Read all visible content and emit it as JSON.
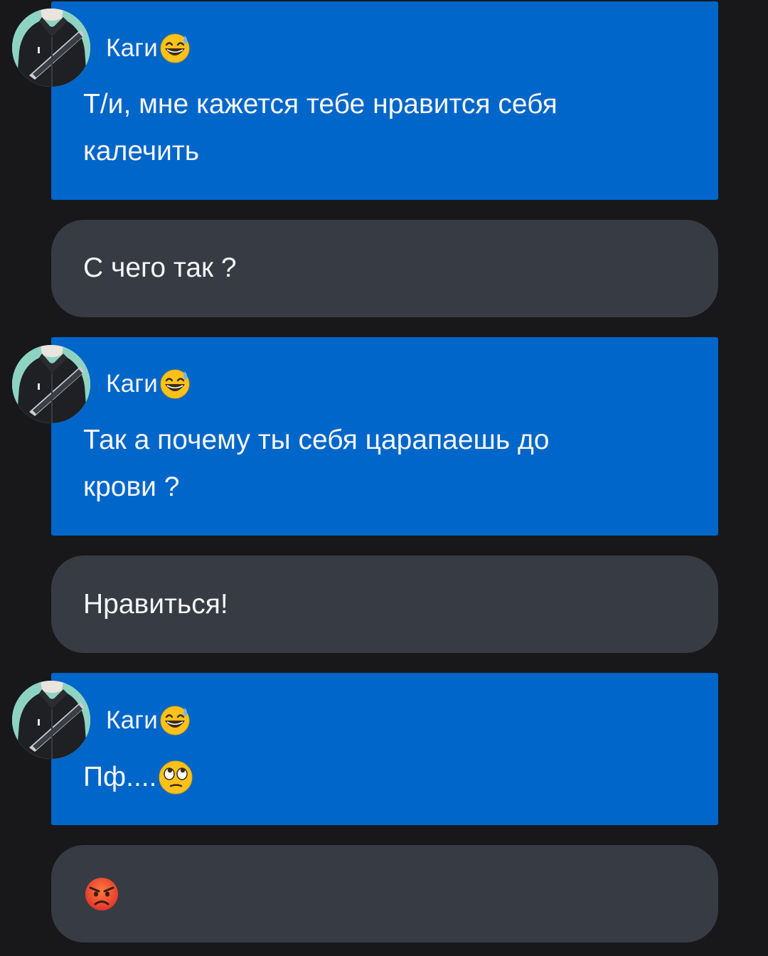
{
  "messages": [
    {
      "type": "received",
      "sender": "Каги",
      "sender_emoji": "grinning-sweat-emoji",
      "lines": [
        "Т/и, мне кажется тебе нравится себя",
        "калечить"
      ]
    },
    {
      "type": "sent",
      "text": "С чего так ?"
    },
    {
      "type": "received",
      "sender": "Каги",
      "sender_emoji": "grinning-sweat-emoji",
      "lines": [
        "Так а почему ты себя царапаешь до",
        "крови ?"
      ]
    },
    {
      "type": "sent",
      "text": "Нравиться!"
    },
    {
      "type": "received",
      "sender": "Каги",
      "sender_emoji": "grinning-sweat-emoji",
      "text": "Пф....",
      "text_emoji": "eye-roll-emoji"
    },
    {
      "type": "sent",
      "emoji": "angry-face-emoji"
    }
  ],
  "colors": {
    "background": "#18181b",
    "received_bubble": "#0066c9",
    "sent_bubble": "#373b44",
    "text": "#f5f6f8",
    "avatar_bg": "#8ed3c2"
  }
}
